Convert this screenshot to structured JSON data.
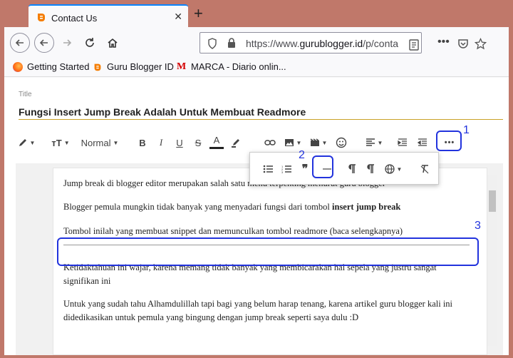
{
  "browser": {
    "tab_title": "Contact Us",
    "url_prefix": "https://www.",
    "url_domain": "gurublogger.id",
    "url_path": "/p/conta",
    "bookmarks": [
      {
        "label": "Getting Started"
      },
      {
        "label": "Guru Blogger ID"
      },
      {
        "label": "MARCA - Diario onlin..."
      }
    ]
  },
  "editor": {
    "title_label": "Title",
    "post_title": "Fungsi Insert Jump Break Adalah Untuk Membuat Readmore",
    "format_select": "Normal",
    "content": {
      "p1": "Jump break di blogger editor merupakan salah satu menu terpenting menurut guru blogger",
      "p2_prefix": "Blogger pemula mungkin tidak banyak yang menyadari fungsi dari tombol ",
      "p2_bold": "insert jump break",
      "p3": "Tombol inilah yang membuat snippet dan memunculkan tombol readmore (baca selengkapnya)",
      "p4": "Ketidaktahuan ini wajar, karena memang tidak banyak yang membicarakan hal sepela yang justru sangat signifikan ini",
      "p5": "Untuk yang sudah tahu Alhamdulillah tapi bagi yang belum harap tenang, karena artikel guru blogger kali ini didedikasikan untuk pemula yang bingung dengan jump break seperti saya dulu :D"
    }
  },
  "annotations": {
    "n1": "1",
    "n2": "2",
    "n3": "3"
  },
  "colors": {
    "accent": "#2233dd",
    "title_underline": "#c9a227"
  }
}
